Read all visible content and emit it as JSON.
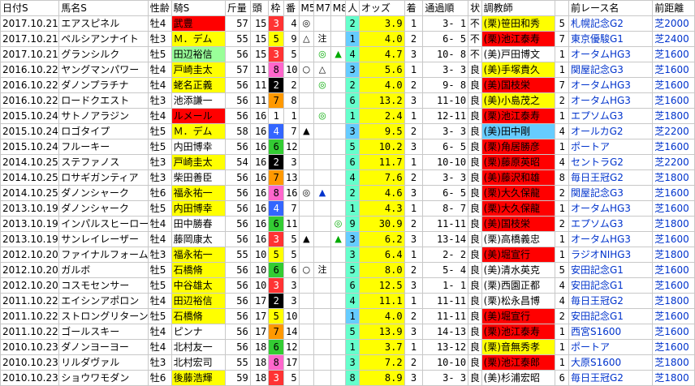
{
  "headers": [
    "日付S",
    "馬名S",
    "性齢",
    "騎S",
    "斤量",
    "頭",
    "枠",
    "番",
    "M5",
    "M7",
    "M8",
    "人",
    "オッズ",
    "着",
    "通過順",
    "状",
    "調教師",
    "",
    "前レース名",
    "前距離"
  ],
  "rows": [
    {
      "date": "2017.10.21",
      "horse": "エアスピネル",
      "sexage": "牡4",
      "jockey": "武豊",
      "weight": "57",
      "heads": "15",
      "waku": "3",
      "ban": "4",
      "m5": "◎",
      "m7": "",
      "m8": "",
      "pop": "2",
      "odds": "3.9",
      "finish": "1",
      "passage": "3- 1",
      "cond": "不",
      "trainer": "(栗)笹田和秀",
      "extra": "5",
      "race": "札幌記念G2",
      "dist": "芝2000",
      "jc": "#ff0000",
      "wc": "#ffff00",
      "hc": "#ffffff",
      "pc": "#66ffcc",
      "fc": "#ffff00",
      "tc": "#ffff00",
      "dc": "#ffffff",
      "rc": "#ffffff"
    },
    {
      "date": "2017.10.21",
      "horse": "ペルシアンナイト",
      "sexage": "牡3",
      "jockey": "Ｍ．デム",
      "weight": "55",
      "heads": "15",
      "waku": "5",
      "ban": "9",
      "m5": "△",
      "m7": "注",
      "m8": "",
      "pop": "1",
      "odds": "4.0",
      "finish": "2",
      "passage": "6- 5",
      "cond": "不",
      "trainer": "(栗)池江泰寿",
      "extra": "7",
      "race": "東京優駿G1",
      "dist": "芝2400",
      "jc": "#ffff00",
      "wc": "#ffff00",
      "hc": "#ffffff",
      "pc": "#66ccff",
      "fc": "#ffff00",
      "tc": "#ff0000",
      "dc": "#ffffff",
      "rc": "#ffffff"
    },
    {
      "date": "2017.10.21",
      "horse": "グランシルク",
      "sexage": "牡5",
      "jockey": "田辺裕信",
      "weight": "56",
      "heads": "15",
      "waku": "3",
      "ban": "5",
      "m5": "",
      "m7": "◎",
      "m8": "▲",
      "pop": "4",
      "odds": "4.7",
      "finish": "3",
      "passage": "10- 8",
      "cond": "不",
      "trainer": "(美)戸田博文",
      "extra": "1",
      "race": "オータムHG3",
      "dist": "芝1600",
      "jc": "#99ff99",
      "wc": "#ffff00",
      "hc": "#ffffff",
      "pc": "#66ffcc",
      "fc": "#ffff00",
      "tc": "#ffffff",
      "dc": "#ffffff",
      "rc": "#ffffff"
    },
    {
      "date": "2016.10.22",
      "horse": "ヤングマンパワー",
      "sexage": "牡4",
      "jockey": "戸崎圭太",
      "weight": "57",
      "heads": "11",
      "waku": "8",
      "ban": "10",
      "m5": "○",
      "m7": "△",
      "m8": "",
      "pop": "3",
      "odds": "5.6",
      "finish": "1",
      "passage": "3- 3",
      "cond": "良",
      "trainer": "(美)手塚貴久",
      "extra": "1",
      "race": "関屋記念G3",
      "dist": "芝1600",
      "jc": "#ffff00",
      "wc": "#ffff00",
      "hc": "#ffffff",
      "pc": "#66ccff",
      "fc": "#ffff00",
      "tc": "#ffff00",
      "dc": "#ffffff",
      "rc": "#ffffff"
    },
    {
      "date": "2016.10.22",
      "horse": "ダノンプラチナ",
      "sexage": "牡4",
      "jockey": "蛯名正義",
      "weight": "56",
      "heads": "11",
      "waku": "2",
      "ban": "2",
      "m5": "",
      "m7": "◎",
      "m8": "",
      "pop": "2",
      "odds": "4.0",
      "finish": "2",
      "passage": "9- 8",
      "cond": "良",
      "trainer": "(美)国枝栄",
      "extra": "7",
      "race": "オータムHG3",
      "dist": "芝1600",
      "jc": "#ffff00",
      "wc": "#ffff00",
      "hc": "#ffffff",
      "pc": "#66ffcc",
      "fc": "#ffff00",
      "tc": "#ff0000",
      "dc": "#ffffff",
      "rc": "#ffffff"
    },
    {
      "date": "2016.10.22",
      "horse": "ロードクエスト",
      "sexage": "牡3",
      "jockey": "池添謙一",
      "weight": "56",
      "heads": "11",
      "waku": "7",
      "ban": "8",
      "m5": "",
      "m7": "",
      "m8": "",
      "pop": "6",
      "odds": "13.2",
      "finish": "3",
      "passage": "11-10",
      "cond": "良",
      "trainer": "(美)小島茂之",
      "extra": "2",
      "race": "オータムHG3",
      "dist": "芝1600",
      "jc": "#ffffff",
      "wc": "#ffff00",
      "hc": "#ffffff",
      "pc": "#66ffcc",
      "fc": "#ffff00",
      "tc": "#ffff00",
      "dc": "#ffffff",
      "rc": "#ffffff"
    },
    {
      "date": "2015.10.24",
      "horse": "サトノアラジン",
      "sexage": "牡4",
      "jockey": "ルメール",
      "weight": "56",
      "heads": "16",
      "waku": "1",
      "ban": "1",
      "m5": "",
      "m7": "◎",
      "m8": "",
      "pop": "1",
      "odds": "2.4",
      "finish": "1",
      "passage": "12-11",
      "cond": "良",
      "trainer": "(栗)池江泰寿",
      "extra": "1",
      "race": "エプソムG3",
      "dist": "芝1800",
      "jc": "#ff0000",
      "wc": "#ffff00",
      "hc": "#ffffff",
      "pc": "#66ffcc",
      "fc": "#ffff00",
      "tc": "#ff0000",
      "dc": "#ffffff",
      "rc": "#ffffff"
    },
    {
      "date": "2015.10.24",
      "horse": "ロゴタイプ",
      "sexage": "牡5",
      "jockey": "Ｍ．デム",
      "weight": "58",
      "heads": "16",
      "waku": "4",
      "ban": "7",
      "m5": "▲",
      "m7": "",
      "m8": "",
      "pop": "3",
      "odds": "9.5",
      "finish": "2",
      "passage": "3- 3",
      "cond": "良",
      "trainer": "(美)田中剛",
      "extra": "4",
      "race": "オールカG2",
      "dist": "芝2200",
      "jc": "#ffff00",
      "wc": "#ffff00",
      "hc": "#ffffff",
      "pc": "#66ccff",
      "fc": "#ffff00",
      "tc": "#66ccff",
      "dc": "#ffffff",
      "rc": "#ffffff"
    },
    {
      "date": "2015.10.24",
      "horse": "フルーキー",
      "sexage": "牡5",
      "jockey": "内田博幸",
      "weight": "56",
      "heads": "16",
      "waku": "6",
      "ban": "12",
      "m5": "",
      "m7": "",
      "m8": "",
      "pop": "5",
      "odds": "10.2",
      "finish": "3",
      "passage": "6- 5",
      "cond": "良",
      "trainer": "(栗)角居勝彦",
      "extra": "1",
      "race": "ポートア",
      "dist": "芝1600",
      "jc": "#ffffff",
      "wc": "#ffff00",
      "hc": "#ffffff",
      "pc": "#66ffcc",
      "fc": "#ffff00",
      "tc": "#ff0000",
      "dc": "#ffffff",
      "rc": "#ffffff"
    },
    {
      "date": "2014.10.25",
      "horse": "ステファノス",
      "sexage": "牡3",
      "jockey": "戸崎圭太",
      "weight": "54",
      "heads": "16",
      "waku": "2",
      "ban": "3",
      "m5": "",
      "m7": "",
      "m8": "",
      "pop": "6",
      "odds": "11.7",
      "finish": "1",
      "passage": "10-10",
      "cond": "良",
      "trainer": "(栗)藤原英昭",
      "extra": "4",
      "race": "セントラG2",
      "dist": "芝2200",
      "jc": "#ffff00",
      "wc": "#ffff00",
      "hc": "#ffffff",
      "pc": "#66ffcc",
      "fc": "#ffff00",
      "tc": "#ff0000",
      "dc": "#ffffff",
      "rc": "#ffffff"
    },
    {
      "date": "2014.10.25",
      "horse": "ロサギガンティア",
      "sexage": "牡3",
      "jockey": "柴田善臣",
      "weight": "56",
      "heads": "16",
      "waku": "7",
      "ban": "13",
      "m5": "",
      "m7": "",
      "m8": "",
      "pop": "4",
      "odds": "7.6",
      "finish": "2",
      "passage": "3- 3",
      "cond": "良",
      "trainer": "(美)藤沢和雄",
      "extra": "8",
      "race": "毎日王冠G2",
      "dist": "芝1800",
      "jc": "#ffffff",
      "wc": "#ffff00",
      "hc": "#ffffff",
      "pc": "#66ffcc",
      "fc": "#ffff00",
      "tc": "#ff0000",
      "dc": "#ffffff",
      "rc": "#ffffff"
    },
    {
      "date": "2014.10.25",
      "horse": "ダノンシャーク",
      "sexage": "牡6",
      "jockey": "福永祐一",
      "weight": "56",
      "heads": "16",
      "waku": "8",
      "ban": "16",
      "m5": "◎",
      "m7": "▲",
      "m8": "",
      "pop": "2",
      "odds": "4.6",
      "finish": "3",
      "passage": "6- 5",
      "cond": "良",
      "trainer": "(栗)大久保龍",
      "extra": "2",
      "race": "関屋記念G3",
      "dist": "芝1600",
      "jc": "#ffff00",
      "wc": "#ffff00",
      "hc": "#ffffff",
      "pc": "#66ffcc",
      "fc": "#ffff00",
      "tc": "#ff0000",
      "dc": "#ffffff",
      "rc": "#ffffff"
    },
    {
      "date": "2013.10.19",
      "horse": "ダノンシャーク",
      "sexage": "牡5",
      "jockey": "内田博幸",
      "weight": "56",
      "heads": "16",
      "waku": "4",
      "ban": "7",
      "m5": "",
      "m7": "",
      "m8": "",
      "pop": "1",
      "odds": "4.3",
      "finish": "1",
      "passage": "8- 7",
      "cond": "良",
      "trainer": "(栗)大久保龍",
      "extra": "1",
      "race": "オータムHG3",
      "dist": "芝1600",
      "jc": "#ffff00",
      "wc": "#ffff00",
      "hc": "#ffffff",
      "pc": "#66ffcc",
      "fc": "#ffff00",
      "tc": "#ff0000",
      "dc": "#ffffff",
      "rc": "#ffffff"
    },
    {
      "date": "2013.10.19",
      "horse": "インパルスヒーロー",
      "sexage": "牡4",
      "jockey": "田中勝春",
      "weight": "56",
      "heads": "16",
      "waku": "6",
      "ban": "11",
      "m5": "",
      "m7": "",
      "m8": "◎",
      "pop": "9",
      "odds": "30.9",
      "finish": "2",
      "passage": "11-11",
      "cond": "良",
      "trainer": "(美)国枝栄",
      "extra": "2",
      "race": "エプソムG3",
      "dist": "芝1800",
      "jc": "#ffffff",
      "wc": "#ffff00",
      "hc": "#ffffff",
      "pc": "#66ffcc",
      "fc": "#ffff00",
      "tc": "#ff0000",
      "dc": "#ffffff",
      "rc": "#ffffff"
    },
    {
      "date": "2013.10.19",
      "horse": "サンレイレーザー",
      "sexage": "牡4",
      "jockey": "藤岡康太",
      "weight": "56",
      "heads": "16",
      "waku": "3",
      "ban": "5",
      "m5": "▲",
      "m7": "",
      "m8": "▲",
      "pop": "3",
      "odds": "6.2",
      "finish": "3",
      "passage": "13-14",
      "cond": "良",
      "trainer": "(栗)高橋義忠",
      "extra": "1",
      "race": "オータムHG3",
      "dist": "芝1600",
      "jc": "#ffffff",
      "wc": "#ffff00",
      "hc": "#ffffff",
      "pc": "#66ccff",
      "fc": "#ffff00",
      "tc": "#ffffff",
      "dc": "#ffffff",
      "rc": "#ffffff"
    },
    {
      "date": "2012.10.20",
      "horse": "ファイナルフォーム",
      "sexage": "牡3",
      "jockey": "福永祐一",
      "weight": "55",
      "heads": "10",
      "waku": "5",
      "ban": "5",
      "m5": "",
      "m7": "",
      "m8": "",
      "pop": "3",
      "odds": "6.4",
      "finish": "1",
      "passage": "2- 2",
      "cond": "良",
      "trainer": "(美)堀宣行",
      "extra": "1",
      "race": "ラジオNIHG3",
      "dist": "芝1800",
      "jc": "#ffff00",
      "wc": "#ffff00",
      "hc": "#ffffff",
      "pc": "#66ffcc",
      "fc": "#ffff00",
      "tc": "#ff0000",
      "dc": "#ffffff",
      "rc": "#ffffff"
    },
    {
      "date": "2012.10.20",
      "horse": "ガルボ",
      "sexage": "牡5",
      "jockey": "石橋脩",
      "weight": "56",
      "heads": "10",
      "waku": "6",
      "ban": "6",
      "m5": "○",
      "m7": "注",
      "m8": "",
      "pop": "5",
      "odds": "8.0",
      "finish": "2",
      "passage": "5- 4",
      "cond": "良",
      "trainer": "(美)清水英克",
      "extra": "5",
      "race": "安田記念G1",
      "dist": "芝1600",
      "jc": "#ffff00",
      "wc": "#ffff00",
      "hc": "#ffffff",
      "pc": "#66ffcc",
      "fc": "#ffff00",
      "tc": "#ffffff",
      "dc": "#ffffff",
      "rc": "#ffffff"
    },
    {
      "date": "2012.10.20",
      "horse": "コスモセンサー",
      "sexage": "牡5",
      "jockey": "中谷雄太",
      "weight": "56",
      "heads": "10",
      "waku": "3",
      "ban": "3",
      "m5": "",
      "m7": "",
      "m8": "",
      "pop": "6",
      "odds": "12.5",
      "finish": "3",
      "passage": "1- 1",
      "cond": "良",
      "trainer": "(栗)西園正都",
      "extra": "4",
      "race": "安田記念G1",
      "dist": "芝1600",
      "jc": "#ffff00",
      "wc": "#ffff00",
      "hc": "#ffffff",
      "pc": "#66ffcc",
      "fc": "#ffff00",
      "tc": "#ffffff",
      "dc": "#ffffff",
      "rc": "#ffffff"
    },
    {
      "date": "2011.10.22",
      "horse": "エイシンアポロン",
      "sexage": "牡4",
      "jockey": "田辺裕信",
      "weight": "56",
      "heads": "17",
      "waku": "2",
      "ban": "3",
      "m5": "",
      "m7": "",
      "m8": "",
      "pop": "4",
      "odds": "11.1",
      "finish": "1",
      "passage": "11-11",
      "cond": "良",
      "trainer": "(栗)松永昌博",
      "extra": "4",
      "race": "毎日王冠G2",
      "dist": "芝1800",
      "jc": "#ffff00",
      "wc": "#ffff00",
      "hc": "#ffffff",
      "pc": "#66ffcc",
      "fc": "#ffff00",
      "tc": "#ffffff",
      "dc": "#ffffff",
      "rc": "#ffffff"
    },
    {
      "date": "2011.10.22",
      "horse": "ストロングリターン",
      "sexage": "牡5",
      "jockey": "石橋脩",
      "weight": "56",
      "heads": "17",
      "waku": "5",
      "ban": "10",
      "m5": "",
      "m7": "",
      "m8": "",
      "pop": "1",
      "odds": "4.0",
      "finish": "2",
      "passage": "11-11",
      "cond": "良",
      "trainer": "(美)堀宣行",
      "extra": "2",
      "race": "安田記念G1",
      "dist": "芝1600",
      "jc": "#ffff00",
      "wc": "#ffff00",
      "hc": "#ffffff",
      "pc": "#66ccff",
      "fc": "#ffff00",
      "tc": "#ff0000",
      "dc": "#ffffff",
      "rc": "#ffffff"
    },
    {
      "date": "2011.10.22",
      "horse": "ゴールスキー",
      "sexage": "牡4",
      "jockey": "ピンナ",
      "weight": "56",
      "heads": "17",
      "waku": "7",
      "ban": "14",
      "m5": "",
      "m7": "",
      "m8": "",
      "pop": "5",
      "odds": "13.9",
      "finish": "3",
      "passage": "14-13",
      "cond": "良",
      "trainer": "(栗)池江泰寿",
      "extra": "1",
      "race": "西宮S1600",
      "dist": "芝1600",
      "jc": "#ffffff",
      "wc": "#ffff00",
      "hc": "#ffffff",
      "pc": "#66ffcc",
      "fc": "#ffff00",
      "tc": "#ff0000",
      "dc": "#ffffff",
      "rc": "#ffffff"
    },
    {
      "date": "2010.10.23",
      "horse": "ダノンヨーヨー",
      "sexage": "牡4",
      "jockey": "北村友一",
      "weight": "56",
      "heads": "18",
      "waku": "6",
      "ban": "12",
      "m5": "",
      "m7": "",
      "m8": "",
      "pop": "1",
      "odds": "3.7",
      "finish": "1",
      "passage": "13-12",
      "cond": "良",
      "trainer": "(栗)音無秀孝",
      "extra": "1",
      "race": "ポートア",
      "dist": "芝1600",
      "jc": "#ffffff",
      "wc": "#ffff00",
      "hc": "#ffffff",
      "pc": "#66ffcc",
      "fc": "#ffff00",
      "tc": "#ffff00",
      "dc": "#ffffff",
      "rc": "#ffffff"
    },
    {
      "date": "2010.10.23",
      "horse": "リルダヴァル",
      "sexage": "牡3",
      "jockey": "北村宏司",
      "weight": "55",
      "heads": "18",
      "waku": "8",
      "ban": "17",
      "m5": "",
      "m7": "",
      "m8": "",
      "pop": "3",
      "odds": "7.2",
      "finish": "2",
      "passage": "10-10",
      "cond": "良",
      "trainer": "(栗)池江泰郎",
      "extra": "1",
      "race": "大原S1600",
      "dist": "芝1800",
      "jc": "#ffffff",
      "wc": "#ffff00",
      "hc": "#ffffff",
      "pc": "#66ffcc",
      "fc": "#ffff00",
      "tc": "#ff0000",
      "dc": "#ffffff",
      "rc": "#ffffff"
    },
    {
      "date": "2010.10.23",
      "horse": "ショウワモダン",
      "sexage": "牡6",
      "jockey": "後藤浩輝",
      "weight": "59",
      "heads": "18",
      "waku": "3",
      "ban": "5",
      "m5": "",
      "m7": "",
      "m8": "",
      "pop": "8",
      "odds": "8.9",
      "finish": "3",
      "passage": "3- 3",
      "cond": "良",
      "trainer": "(美)杉浦宏昭",
      "extra": "6",
      "race": "毎日王冠G2",
      "dist": "芝1800",
      "jc": "#ffff00",
      "wc": "#ffff00",
      "hc": "#ffffff",
      "pc": "#66ffcc",
      "fc": "#ffff00",
      "tc": "#ffffff",
      "dc": "#ffffff",
      "rc": "#ffffff"
    }
  ],
  "colors": {
    "waku": [
      "#ffffff",
      "#000000",
      "#ff3333",
      "#3366ff",
      "#ffff00",
      "#33cc33",
      "#ff9900",
      "#ff66cc"
    ],
    "header_bg": "#ffffff",
    "grid": "#c8c8c8",
    "marker_green": "#00aa00",
    "marker_blue": "#0033cc"
  }
}
